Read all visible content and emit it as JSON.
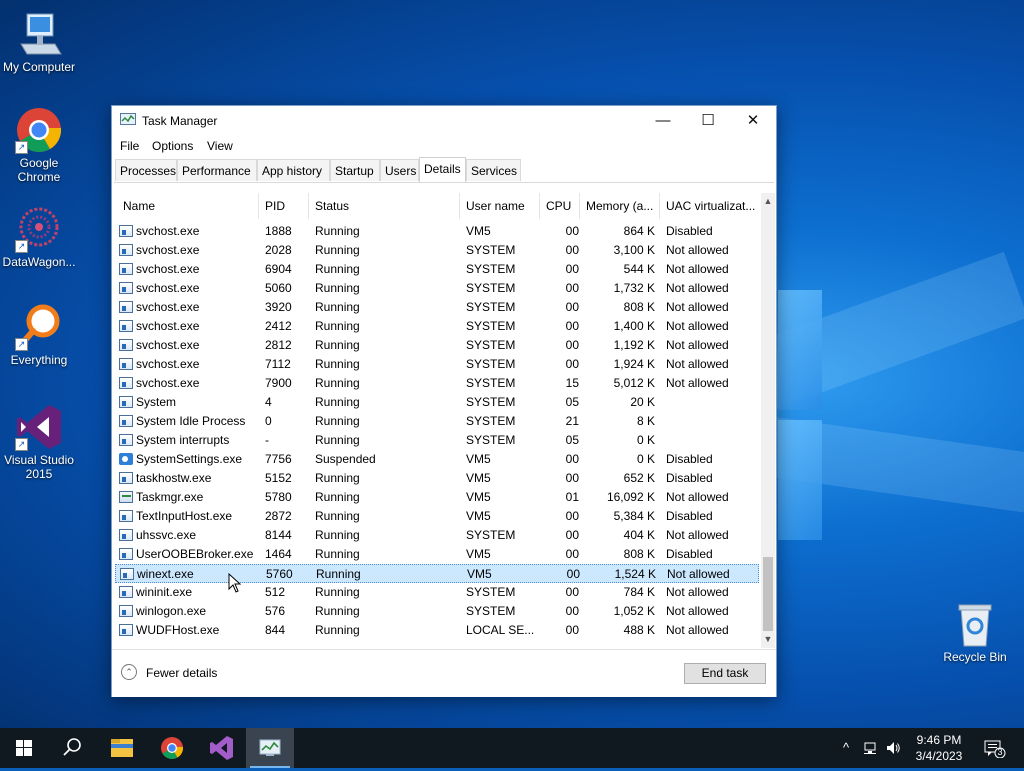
{
  "desktop": {
    "icons": [
      {
        "label": "My Computer"
      },
      {
        "label": "Google Chrome"
      },
      {
        "label": "DataWagon..."
      },
      {
        "label": "Everything"
      },
      {
        "label": "Visual Studio 2015"
      },
      {
        "label": "Recycle Bin"
      }
    ]
  },
  "window": {
    "title": "Task Manager",
    "controls": {
      "minimize": "—",
      "maximize": "☐",
      "close": "✕"
    },
    "menu": [
      "File",
      "Options",
      "View"
    ],
    "tabs": [
      "Processes",
      "Performance",
      "App history",
      "Startup",
      "Users",
      "Details",
      "Services"
    ],
    "active_tab": "Details",
    "columns": [
      "Name",
      "PID",
      "Status",
      "User name",
      "CPU",
      "Memory (a...",
      "UAC virtualizat..."
    ],
    "rows": [
      {
        "name": "svchost.exe",
        "pid": "1888",
        "status": "Running",
        "user": "VM5",
        "cpu": "00",
        "mem": "864 K",
        "uac": "Disabled"
      },
      {
        "name": "svchost.exe",
        "pid": "2028",
        "status": "Running",
        "user": "SYSTEM",
        "cpu": "00",
        "mem": "3,100 K",
        "uac": "Not allowed"
      },
      {
        "name": "svchost.exe",
        "pid": "6904",
        "status": "Running",
        "user": "SYSTEM",
        "cpu": "00",
        "mem": "544 K",
        "uac": "Not allowed"
      },
      {
        "name": "svchost.exe",
        "pid": "5060",
        "status": "Running",
        "user": "SYSTEM",
        "cpu": "00",
        "mem": "1,732 K",
        "uac": "Not allowed"
      },
      {
        "name": "svchost.exe",
        "pid": "3920",
        "status": "Running",
        "user": "SYSTEM",
        "cpu": "00",
        "mem": "808 K",
        "uac": "Not allowed"
      },
      {
        "name": "svchost.exe",
        "pid": "2412",
        "status": "Running",
        "user": "SYSTEM",
        "cpu": "00",
        "mem": "1,400 K",
        "uac": "Not allowed"
      },
      {
        "name": "svchost.exe",
        "pid": "2812",
        "status": "Running",
        "user": "SYSTEM",
        "cpu": "00",
        "mem": "1,192 K",
        "uac": "Not allowed"
      },
      {
        "name": "svchost.exe",
        "pid": "7112",
        "status": "Running",
        "user": "SYSTEM",
        "cpu": "00",
        "mem": "1,924 K",
        "uac": "Not allowed"
      },
      {
        "name": "svchost.exe",
        "pid": "7900",
        "status": "Running",
        "user": "SYSTEM",
        "cpu": "15",
        "mem": "5,012 K",
        "uac": "Not allowed"
      },
      {
        "name": "System",
        "pid": "4",
        "status": "Running",
        "user": "SYSTEM",
        "cpu": "05",
        "mem": "20 K",
        "uac": ""
      },
      {
        "name": "System Idle Process",
        "pid": "0",
        "status": "Running",
        "user": "SYSTEM",
        "cpu": "21",
        "mem": "8 K",
        "uac": ""
      },
      {
        "name": "System interrupts",
        "pid": "-",
        "status": "Running",
        "user": "SYSTEM",
        "cpu": "05",
        "mem": "0 K",
        "uac": ""
      },
      {
        "name": "SystemSettings.exe",
        "pid": "7756",
        "status": "Suspended",
        "user": "VM5",
        "cpu": "00",
        "mem": "0 K",
        "uac": "Disabled"
      },
      {
        "name": "taskhostw.exe",
        "pid": "5152",
        "status": "Running",
        "user": "VM5",
        "cpu": "00",
        "mem": "652 K",
        "uac": "Disabled"
      },
      {
        "name": "Taskmgr.exe",
        "pid": "5780",
        "status": "Running",
        "user": "VM5",
        "cpu": "01",
        "mem": "16,092 K",
        "uac": "Not allowed"
      },
      {
        "name": "TextInputHost.exe",
        "pid": "2872",
        "status": "Running",
        "user": "VM5",
        "cpu": "00",
        "mem": "5,384 K",
        "uac": "Disabled"
      },
      {
        "name": "uhssvc.exe",
        "pid": "8144",
        "status": "Running",
        "user": "SYSTEM",
        "cpu": "00",
        "mem": "404 K",
        "uac": "Not allowed"
      },
      {
        "name": "UserOOBEBroker.exe",
        "pid": "1464",
        "status": "Running",
        "user": "VM5",
        "cpu": "00",
        "mem": "808 K",
        "uac": "Disabled"
      },
      {
        "name": "winext.exe",
        "pid": "5760",
        "status": "Running",
        "user": "VM5",
        "cpu": "00",
        "mem": "1,524 K",
        "uac": "Not allowed"
      },
      {
        "name": "wininit.exe",
        "pid": "512",
        "status": "Running",
        "user": "SYSTEM",
        "cpu": "00",
        "mem": "784 K",
        "uac": "Not allowed"
      },
      {
        "name": "winlogon.exe",
        "pid": "576",
        "status": "Running",
        "user": "SYSTEM",
        "cpu": "00",
        "mem": "1,052 K",
        "uac": "Not allowed"
      },
      {
        "name": "WUDFHost.exe",
        "pid": "844",
        "status": "Running",
        "user": "LOCAL SE...",
        "cpu": "00",
        "mem": "488 K",
        "uac": "Not allowed"
      }
    ],
    "selected_row": "winext.exe",
    "footer": {
      "fewer_details": "Fewer details",
      "end_task": "End task"
    }
  },
  "taskbar": {
    "time": "9:46 PM",
    "date": "3/4/2023",
    "notification_count": "3"
  }
}
